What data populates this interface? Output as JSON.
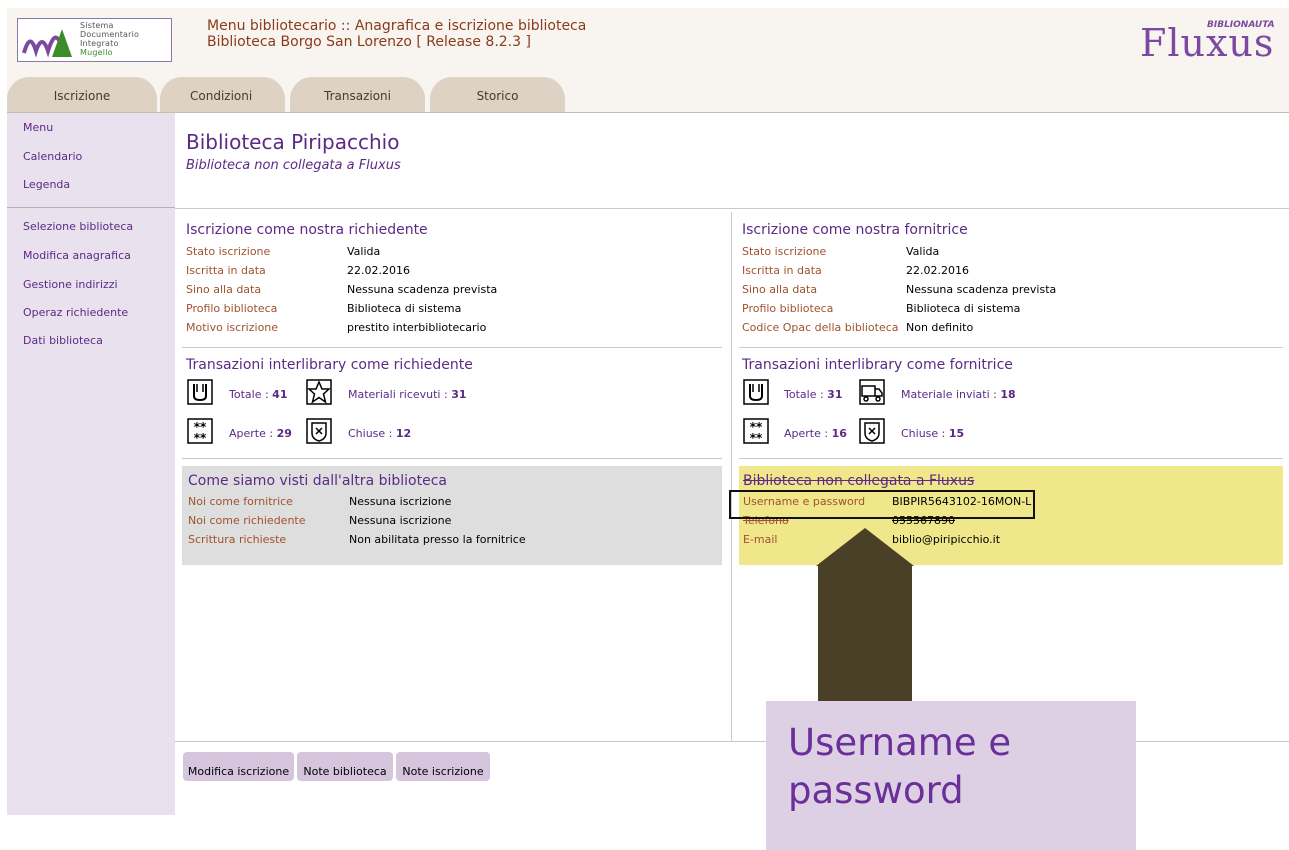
{
  "header": {
    "logo_lines": [
      "Sistema",
      "Documentario",
      "Integrato",
      "Mugello"
    ],
    "title_line1": "Menu bibliotecario :: Anagrafica e iscrizione biblioteca",
    "title_line2": "Biblioteca Borgo San Lorenzo [ Release 8.2.3 ]",
    "brand": "Fluxus",
    "brand_sub": "BIBLIONAUTA"
  },
  "tabs": [
    "Iscrizione",
    "Condizioni",
    "Transazioni",
    "Storico"
  ],
  "sidebar": {
    "group1": [
      "Menu",
      "Calendario",
      "Legenda"
    ],
    "group2": [
      "Selezione biblioteca",
      "Modifica anagrafica",
      "Gestione indirizzi",
      "Operaz richiedente",
      "Dati biblioteca"
    ]
  },
  "main": {
    "title": "Biblioteca Piripacchio",
    "subtitle": "Biblioteca non collegata a Fluxus"
  },
  "left": {
    "iscrizione_title": "Iscrizione come nostra richiedente",
    "iscrizione_rows": [
      {
        "label": "Stato iscrizione",
        "value": "Valida"
      },
      {
        "label": "Iscritta in data",
        "value": "22.02.2016"
      },
      {
        "label": "Sino alla data",
        "value": "Nessuna scadenza prevista"
      },
      {
        "label": "Profilo biblioteca",
        "value": "Biblioteca di sistema"
      },
      {
        "label": "Motivo iscrizione",
        "value": "prestito interbibliotecario"
      }
    ],
    "trans_title": "Transazioni interlibrary come richiedente",
    "stats": [
      {
        "label": "Totale : ",
        "value": "41"
      },
      {
        "label": "Materiali ricevuti : ",
        "value": "31"
      },
      {
        "label": "Aperte : ",
        "value": "29"
      },
      {
        "label": "Chiuse : ",
        "value": "12"
      }
    ],
    "panel_title": "Come siamo visti dall'altra biblioteca",
    "panel_rows": [
      {
        "label": "Noi come fornitrice",
        "value": "Nessuna iscrizione"
      },
      {
        "label": "Noi come richiedente",
        "value": "Nessuna iscrizione"
      },
      {
        "label": "Scrittura richieste",
        "value": "Non abilitata presso la fornitrice"
      }
    ]
  },
  "right": {
    "iscrizione_title": "Iscrizione come nostra fornitrice",
    "iscrizione_rows": [
      {
        "label": "Stato iscrizione",
        "value": "Valida"
      },
      {
        "label": "Iscritta in data",
        "value": "22.02.2016"
      },
      {
        "label": "Sino alla data",
        "value": "Nessuna scadenza prevista"
      },
      {
        "label": "Profilo biblioteca",
        "value": "Biblioteca di sistema"
      },
      {
        "label": "Codice Opac della biblioteca",
        "value": "Non definito"
      }
    ],
    "trans_title": "Transazioni interlibrary come fornitrice",
    "stats": [
      {
        "label": "Totale : ",
        "value": "31"
      },
      {
        "label": "Materiale inviati : ",
        "value": "18"
      },
      {
        "label": "Aperte : ",
        "value": "16"
      },
      {
        "label": "Chiuse : ",
        "value": "15"
      }
    ],
    "panel_title": "Biblioteca non collegata a Fluxus",
    "panel_rows": [
      {
        "label": "Username e password",
        "value": "BIBPIR5643102-16MON-L"
      },
      {
        "label": "Telefono",
        "value": "055567890"
      },
      {
        "label": "E-mail",
        "value": "biblio@piripicchio.it"
      }
    ]
  },
  "callout": {
    "line1": "Username e",
    "line2": "password"
  },
  "buttons": [
    "Modifica iscrizione",
    "Note biblioteca",
    "Note iscrizione"
  ],
  "colors": {
    "accent": "#5c2a86",
    "label": "#a0522d",
    "highlight_panel": "#f0e68a",
    "arrow": "#4a3f27",
    "callout_bg": "#ddd0e5"
  }
}
